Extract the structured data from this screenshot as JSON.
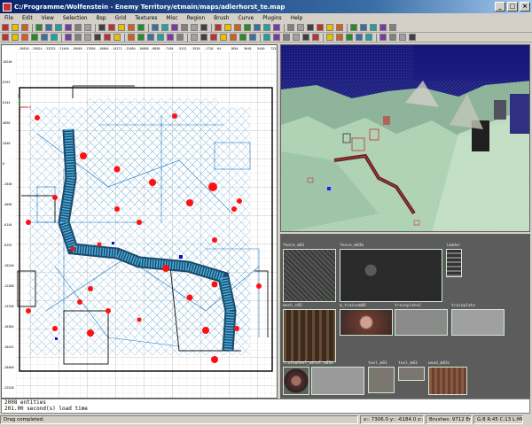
{
  "window": {
    "title": "C:/Programme/Wolfenstein - Enemy Territory/etmain/maps/adlerhorst_te.map",
    "controls": {
      "minimize": "_",
      "maximize": "□",
      "close": "×"
    }
  },
  "menu": [
    "File",
    "Edit",
    "View",
    "Selection",
    "Bsp",
    "Grid",
    "Textures",
    "Misc",
    "Region",
    "Brush",
    "Curve",
    "Plugins",
    "Help"
  ],
  "grid_view": {
    "x_ruler": [
      "-26816",
      "-25024",
      "-23232",
      "-21440",
      "-19648",
      "-17856",
      "-16064",
      "-14272",
      "-12480",
      "-10688",
      "-8896",
      "-7104",
      "-5312",
      "-3520",
      "-1728",
      "64",
      "1856",
      "3648",
      "5440",
      "7232"
    ],
    "y_ruler": [
      "10240",
      "8192",
      "6144",
      "4096",
      "2048",
      "0",
      "-2048",
      "-4096",
      "-6144",
      "-8192",
      "-10240",
      "-12288",
      "-14336",
      "-16384",
      "-18432",
      "-20480",
      "-22528"
    ],
    "axis_labels": {
      "x": "x",
      "y": "y"
    }
  },
  "textures": [
    {
      "name": "fence_m01"
    },
    {
      "name": "fence_m03b"
    },
    {
      "name": "ladder"
    },
    {
      "name": "mesh_c05"
    },
    {
      "name": "m_trainsm06"
    },
    {
      "name": "trainplate1"
    },
    {
      "name": "trainplate"
    },
    {
      "name": "trainwheel_metal_m03b"
    },
    {
      "name": "tool_m01"
    },
    {
      "name": "tool_m03"
    },
    {
      "name": "wood_m03c"
    }
  ],
  "console": [
    "2008 entities",
    "201.00 second(s) load time"
  ],
  "status": {
    "message": "Drag completed.",
    "coords": "x:: 7306.0  y:: -6184.0  z:: 0.0",
    "brush_info": "Brushes: 9712 Entities: 1482",
    "grid_info": "G:8 R:45 C:13 L:MR"
  },
  "colors": {
    "title_start": "#0a246a",
    "selection": "#ff0000",
    "brush_lines": "#1a78c2",
    "terrain": "#b8d8b8",
    "sky": "#2a2a90"
  }
}
